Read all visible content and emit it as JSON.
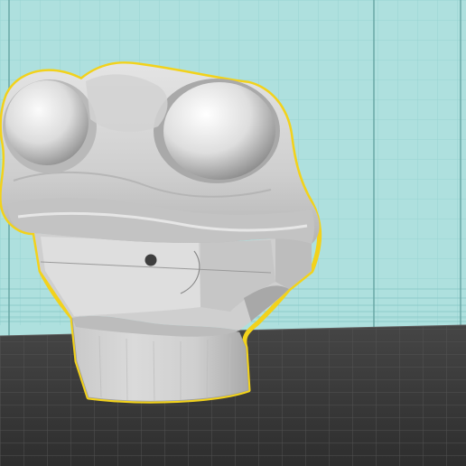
{
  "viewport": {
    "background_color": "#aee0de",
    "grid_line_color": "#8fcfcf",
    "frame_line_color": "#5a9694",
    "bed_color": "#3a3a3a",
    "bed_grid_color": "#4a4a4a"
  },
  "model": {
    "name": "",
    "outline_color": "#f2d21b",
    "body_color": "#d6d6d6",
    "highlight_color": "#f6f6f6",
    "shadow_color": "#9a9a9a",
    "selected": true
  }
}
